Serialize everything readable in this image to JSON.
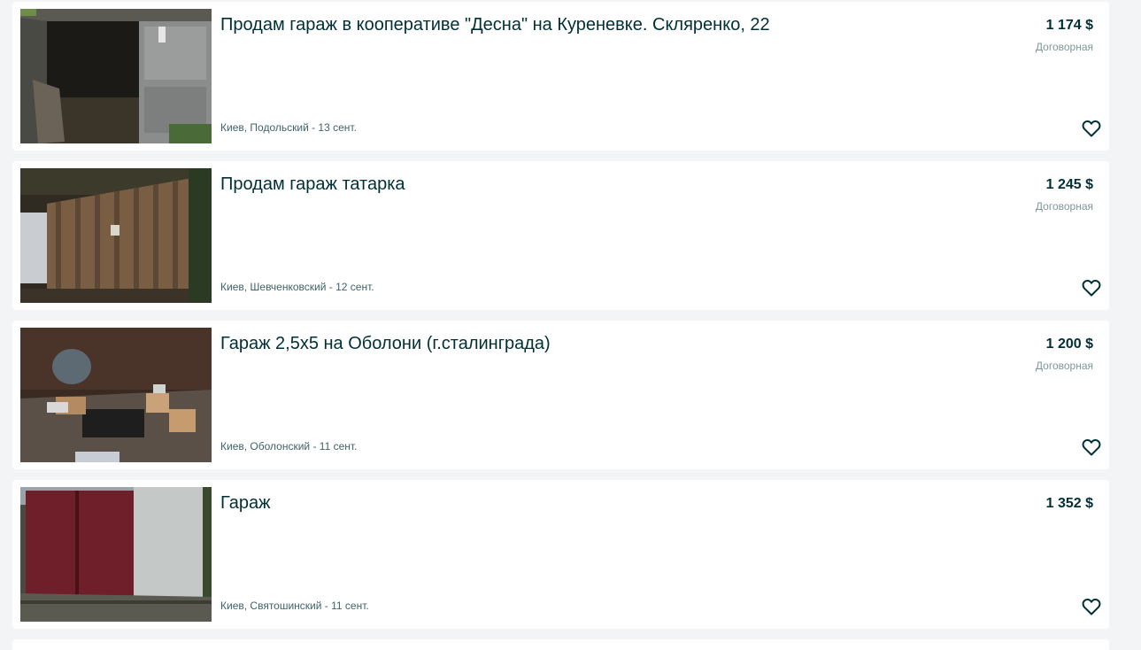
{
  "listings": [
    {
      "title": "Продам гараж в кооперативе \"Десна\" на Куреневке. Скляренко, 22",
      "price": "1 174 $",
      "negotiable": "Договорная",
      "location": "Киев, Подольский - 13 сент.",
      "image": "garage-open-door-photo"
    },
    {
      "title": "Продам гараж татарка",
      "price": "1 245 $",
      "negotiable": "Договорная",
      "location": "Киев, Шевченковский - 12 сент.",
      "image": "wooden-garage-photo"
    },
    {
      "title": "Гараж 2,5х5 на Оболони (г.сталинграда)",
      "price": "1 200 $",
      "negotiable": "Договорная",
      "location": "Киев, Оболонский - 11 сент.",
      "image": "garage-interior-photo"
    },
    {
      "title": "Гараж",
      "price": "1 352 $",
      "negotiable": "",
      "location": "Киев, Святошинский - 11 сент.",
      "image": "metal-garage-photo"
    }
  ],
  "icons": {
    "favorite": "heart-outline-icon"
  },
  "colors": {
    "background": "#f2f4f5",
    "card": "#ffffff",
    "text": "#002f34",
    "muted": "#7f9799"
  }
}
